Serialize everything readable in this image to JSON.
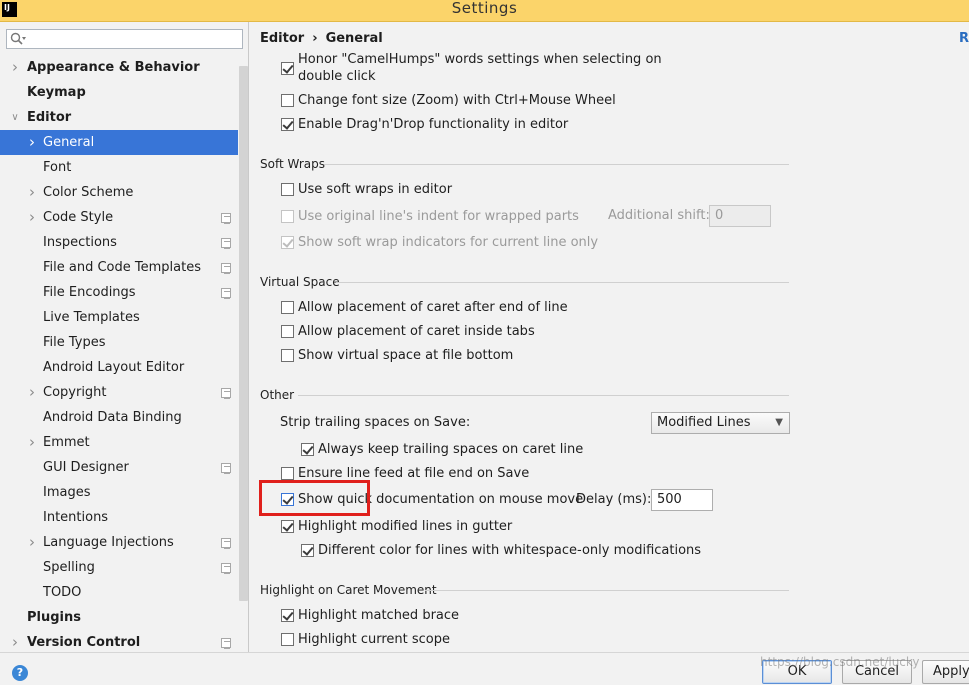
{
  "window": {
    "title": "Settings",
    "app_icon": "IJ"
  },
  "search": {
    "placeholder": ""
  },
  "sidebar": {
    "items": [
      {
        "label": "Appearance & Behavior",
        "level": 0,
        "bold": true,
        "expandable": true,
        "expanded": false
      },
      {
        "label": "Keymap",
        "level": 0,
        "bold": true
      },
      {
        "label": "Editor",
        "level": 0,
        "bold": true,
        "expandable": true,
        "expanded": true
      },
      {
        "label": "General",
        "level": 1,
        "expandable": true,
        "selected": true
      },
      {
        "label": "Font",
        "level": 1
      },
      {
        "label": "Color Scheme",
        "level": 1,
        "expandable": true
      },
      {
        "label": "Code Style",
        "level": 1,
        "expandable": true,
        "project_icon": true
      },
      {
        "label": "Inspections",
        "level": 1,
        "project_icon": true
      },
      {
        "label": "File and Code Templates",
        "level": 1,
        "project_icon": true
      },
      {
        "label": "File Encodings",
        "level": 1,
        "project_icon": true
      },
      {
        "label": "Live Templates",
        "level": 1
      },
      {
        "label": "File Types",
        "level": 1
      },
      {
        "label": "Android Layout Editor",
        "level": 1
      },
      {
        "label": "Copyright",
        "level": 1,
        "expandable": true,
        "project_icon": true
      },
      {
        "label": "Android Data Binding",
        "level": 1
      },
      {
        "label": "Emmet",
        "level": 1,
        "expandable": true
      },
      {
        "label": "GUI Designer",
        "level": 1,
        "project_icon": true
      },
      {
        "label": "Images",
        "level": 1
      },
      {
        "label": "Intentions",
        "level": 1
      },
      {
        "label": "Language Injections",
        "level": 1,
        "expandable": true,
        "project_icon": true
      },
      {
        "label": "Spelling",
        "level": 1,
        "project_icon": true
      },
      {
        "label": "TODO",
        "level": 1
      },
      {
        "label": "Plugins",
        "level": 0,
        "bold": true
      },
      {
        "label": "Version Control",
        "level": 0,
        "bold": true,
        "expandable": true,
        "project_icon": true
      }
    ]
  },
  "breadcrumb": {
    "part1": "Editor",
    "sep": "›",
    "part2": "General",
    "reset": "R"
  },
  "options": {
    "camel_humps_line1": "Honor \"CamelHumps\" words settings when selecting on",
    "camel_humps_line2": "double click",
    "camel_humps_checked": true,
    "font_zoom": "Change font size (Zoom) with Ctrl+Mouse Wheel",
    "font_zoom_checked": false,
    "drag_drop": "Enable Drag'n'Drop functionality in editor",
    "drag_drop_checked": true
  },
  "soft_wraps": {
    "title": "Soft Wraps",
    "use_soft_wraps": "Use soft wraps in editor",
    "use_soft_wraps_checked": false,
    "original_indent": "Use original line's indent for wrapped parts",
    "additional_shift_label": "Additional shift:",
    "additional_shift_value": "0",
    "show_indicators": "Show soft wrap indicators for current line only",
    "show_indicators_checked": true
  },
  "virtual_space": {
    "title": "Virtual Space",
    "after_end": "Allow placement of caret after end of line",
    "inside_tabs": "Allow placement of caret inside tabs",
    "file_bottom": "Show virtual space at file bottom"
  },
  "other": {
    "title": "Other",
    "strip_label": "Strip trailing spaces on Save:",
    "strip_value": "Modified Lines",
    "keep_trailing": "Always keep trailing spaces on caret line",
    "keep_trailing_checked": true,
    "line_feed": "Ensure line feed at file end on Save",
    "line_feed_checked": false,
    "quick_doc": "Show quick documentation on mouse move",
    "quick_doc_checked": true,
    "delay_label": "Delay (ms):",
    "delay_value": "500",
    "highlight_modified": "Highlight modified lines in gutter",
    "highlight_modified_checked": true,
    "whitespace_color": "Different color for lines with whitespace-only modifications",
    "whitespace_color_checked": true
  },
  "caret_movement": {
    "title": "Highlight on Caret Movement",
    "matched_brace": "Highlight matched brace",
    "matched_brace_checked": true,
    "current_scope": "Highlight current scope",
    "current_scope_checked": false
  },
  "buttons": {
    "ok": "OK",
    "cancel": "Cancel",
    "apply": "Apply",
    "help": "?"
  },
  "watermark": "https://blog.csdn.net/lucky",
  "colors": {
    "title_bar": "#fbd46a",
    "selection": "#3875d7",
    "highlight_box": "#e0201c"
  }
}
